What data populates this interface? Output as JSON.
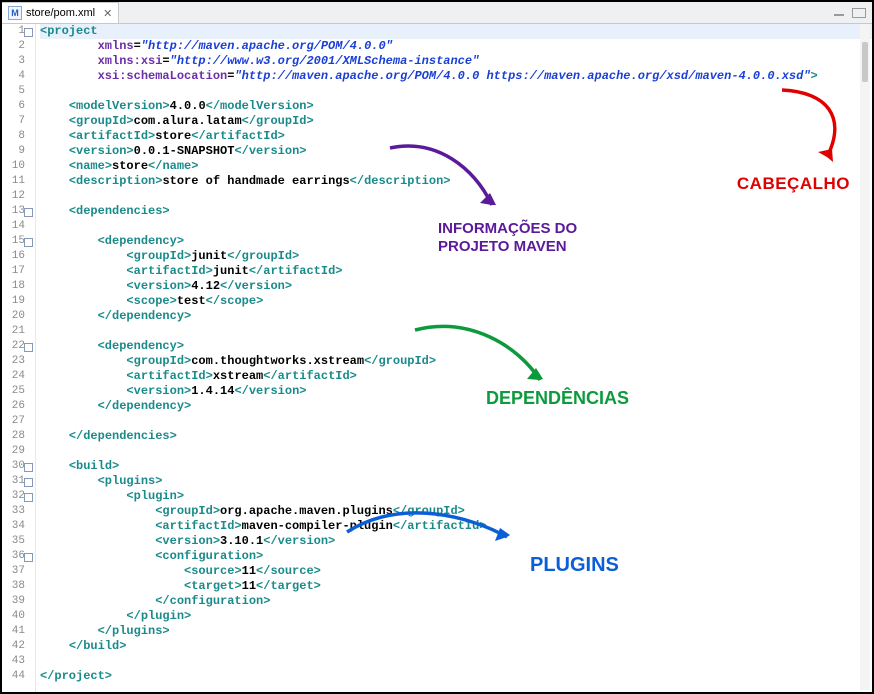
{
  "tab": {
    "icon_letter": "M",
    "title": "store/pom.xml"
  },
  "annotations": {
    "cabecalho": "CABEÇALHO",
    "info_line1": "INFORMAÇÕES DO",
    "info_line2": "PROJETO MAVEN",
    "dependencias": "DEPENDÊNCIAS",
    "plugins": "PLUGINS"
  },
  "gutter": {
    "fold_lines": [
      1,
      13,
      15,
      22,
      30,
      31,
      32,
      36
    ],
    "start": 1,
    "end": 44
  },
  "code_tokens": {
    "project": "project",
    "xmlns": "xmlns",
    "xmlns_val": "\"http://maven.apache.org/POM/4.0.0\"",
    "xmlns_xsi": "xmlns:xsi",
    "xmlns_xsi_val": "\"http://www.w3.org/2001/XMLSchema-instance\"",
    "xsi_schemaLocation": "xsi:schemaLocation",
    "xsi_schemaLocation_val": "\"http://maven.apache.org/POM/4.0.0 https://maven.apache.org/xsd/maven-4.0.0.xsd\"",
    "modelVersion": "modelVersion",
    "modelVersion_val": "4.0.0",
    "groupId": "groupId",
    "groupId_val": "com.alura.latam",
    "artifactId": "artifactId",
    "artifactId_val": "store",
    "version": "version",
    "version_val": "0.0.1-SNAPSHOT",
    "name": "name",
    "name_val": "store",
    "description": "description",
    "description_val": "store of handmade earrings",
    "dependencies": "dependencies",
    "dependency": "dependency",
    "junit_group": "junit",
    "junit_artifact": "junit",
    "junit_version": "4.12",
    "scope": "scope",
    "scope_val": "test",
    "xstream_group": "com.thoughtworks.xstream",
    "xstream_artifact": "xstream",
    "xstream_version": "1.4.14",
    "build": "build",
    "plugins": "plugins",
    "plugin": "plugin",
    "plugin_group": "org.apache.maven.plugins",
    "plugin_artifact": "maven-compiler-plugin",
    "plugin_version": "3.10.1",
    "configuration": "configuration",
    "source": "source",
    "source_val": "11",
    "target": "target",
    "target_val": "11"
  }
}
